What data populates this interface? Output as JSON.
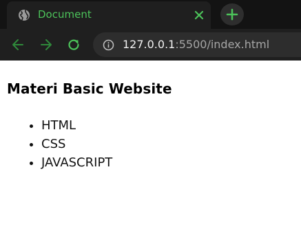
{
  "tab": {
    "title": "Document",
    "favicon_icon": "globe-icon",
    "close_icon": "close-icon"
  },
  "new_tab_icon": "plus-icon",
  "toolbar": {
    "back_icon": "arrow-left-icon",
    "forward_icon": "arrow-right-icon",
    "reload_icon": "reload-icon",
    "info_icon": "info-icon",
    "url_host": "127.0.0.1",
    "url_rest": ":5500/index.html"
  },
  "colors": {
    "tab_accent": "#4cc35a",
    "tabstrip_bg": "#131313",
    "toolbar_bg": "#1f1f1f",
    "omnibox_bg": "#2d2d2d"
  },
  "page": {
    "heading": "Materi Basic Website",
    "list": [
      "HTML",
      "CSS",
      "JAVASCRIPT"
    ]
  }
}
